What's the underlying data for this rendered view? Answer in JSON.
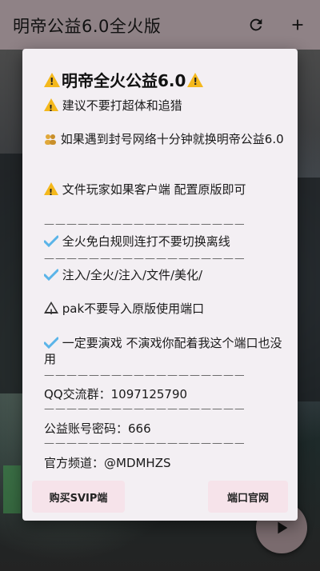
{
  "app": {
    "title": "明帝公益6.0全火版",
    "refresh_icon": "refresh-icon",
    "add_icon": "plus-icon"
  },
  "dialog": {
    "title": "明帝全火公益6.0",
    "lines": [
      "建议不要打超体和追猎",
      "如果遇到封号网络十分钟就换明帝公益6.0",
      "文件玩家如果客户端 配置原版即可",
      "全火免白规则连打不要切换离线",
      "注入/全火/注入/文件/美化/",
      "pak不要导入原版使用端口",
      "一定要演戏 不演戏你配着我这个端口也没用",
      "QQ交流群：1097125790",
      "公益账号密码：666",
      "官方频道：@MDMHZS"
    ],
    "separator": "———————————————————————",
    "buttons": {
      "buy": "购买SVIP端",
      "official": "端口官网"
    }
  },
  "fab": {
    "icon": "play-icon"
  },
  "colors": {
    "appbar": "#8f8286",
    "dialog_bg": "#f3eff3",
    "button_bg": "#f6e3ea",
    "warning": "#f4b81c",
    "check": "#5ab4e8"
  }
}
